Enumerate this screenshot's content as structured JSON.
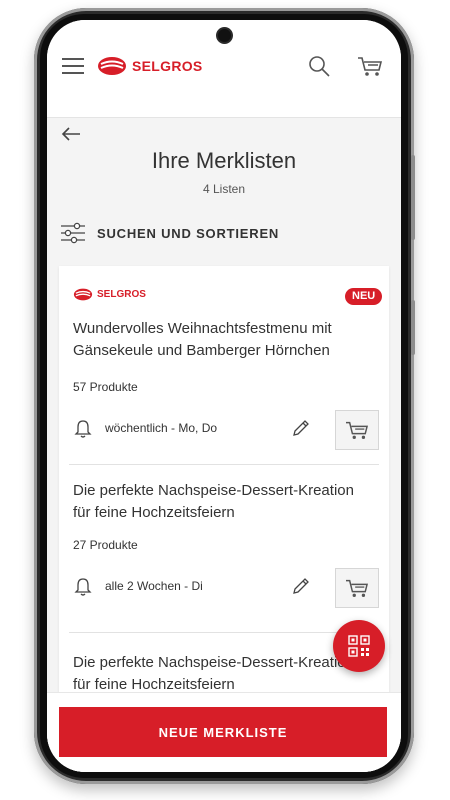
{
  "header": {
    "logo_text": "SELGROS"
  },
  "page": {
    "title": "Ihre Merklisten",
    "subtitle": "4 Listen",
    "filter_label": "SUCHEN UND SORTIEREN"
  },
  "lists": [
    {
      "brand": "SELGROS",
      "badge": "NEU",
      "title": "Wundervolles Weihnachtsfestmenu mit Gänsekeule und Bamberger Hörnchen",
      "count": "57 Produkte",
      "frequency": "wöchentlich - Mo, Do"
    },
    {
      "title": "Die perfekte Nachspeise-Dessert-Kreation für feine Hochzeitsfeiern",
      "count": "27 Produkte",
      "frequency": "alle 2 Wochen - Di"
    },
    {
      "title": "Die perfekte Nachspeise-Dessert-Kreation für feine Hochzeitsfeiern"
    }
  ],
  "footer": {
    "new_list_label": "NEUE MERKLISTE"
  },
  "colors": {
    "brand_red": "#d71e28",
    "background": "#f4f4f4"
  },
  "icons": [
    "menu-icon",
    "search-icon",
    "cart-icon",
    "back-arrow-icon",
    "filter-icon",
    "bell-icon",
    "pencil-icon",
    "qr-code-icon"
  ]
}
